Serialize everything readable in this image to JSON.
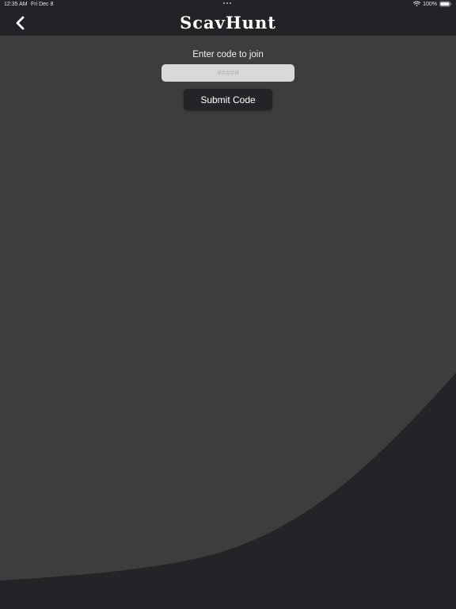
{
  "status_bar": {
    "time": "12:35 AM",
    "date": "Fri Dec 8",
    "battery": "100%"
  },
  "nav": {
    "title": "ScavHunt"
  },
  "join": {
    "prompt": "Enter code to join",
    "input_value": "",
    "input_placeholder": "#####",
    "submit_label": "Submit Code"
  },
  "colors": {
    "background": "#3d3d3d",
    "bars": "#222326",
    "input": "#d9d9d9",
    "button": "#232427",
    "curve": "#232427"
  },
  "icons": {
    "back": "chevron-left-icon",
    "wifi": "wifi-icon",
    "battery": "battery-icon"
  }
}
